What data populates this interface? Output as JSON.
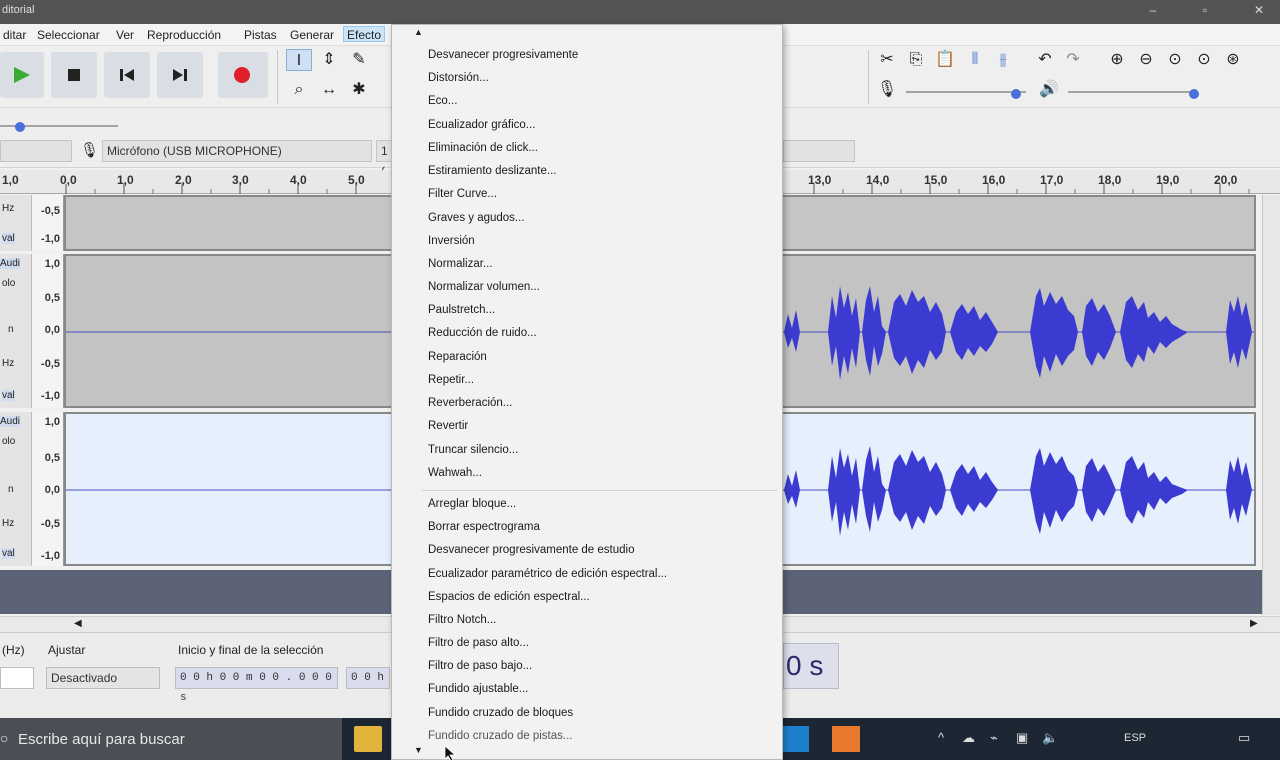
{
  "window": {
    "title": "ditorial"
  },
  "menubar": {
    "items": [
      "ditar",
      "Seleccionar",
      "Ver",
      "Reproducción",
      "Pistas",
      "Generar",
      "Efecto"
    ],
    "active": "Efecto"
  },
  "device_bar": {
    "microphone": "Micrófono (USB MICROPHONE)",
    "channels": "1 ("
  },
  "ruler": {
    "left_ticks": [
      "1,0",
      "0,0",
      "1,0",
      "2,0",
      "3,0",
      "4,0",
      "5,0"
    ],
    "right_ticks": [
      "13,0",
      "14,0",
      "15,0",
      "16,0",
      "17,0",
      "18,0",
      "19,0",
      "20,0"
    ]
  },
  "tracks": {
    "scale_top": [
      "-0,5",
      "-1,0"
    ],
    "scale_mid": [
      "1,0",
      "0,5",
      "0,0",
      "-0,5",
      "-1,0"
    ],
    "scale_bot": [
      "1,0",
      "0,5",
      "0,0",
      "-0,5",
      "-1,0"
    ],
    "ctl_labels_top": [
      "Hz",
      "val"
    ],
    "ctl_labels_mid": [
      "Audi",
      "olo",
      "n",
      "Hz",
      "val"
    ],
    "ctl_labels_bot": [
      "Audi",
      "olo",
      "n",
      "Hz",
      "val"
    ]
  },
  "bottom": {
    "rate_label": "(Hz)",
    "snap_label": "Ajustar",
    "snap_value": "Desactivado",
    "selection_label": "Inicio y final de la selección",
    "start_time": "0 0 h 0 0 m 0 0 . 0 0 0 s",
    "end_time": "0 0 h",
    "big_time": "0 s"
  },
  "taskbar": {
    "search_placeholder": "Escribe aquí para buscar",
    "lang": "ESP"
  },
  "effect_menu": {
    "items_group1": [
      "Desvanecer progresivamente",
      "Distorsión...",
      "Eco...",
      "Ecualizador gráfico...",
      "Eliminación de click...",
      "Estiramiento deslizante...",
      "Filter Curve...",
      "Graves y agudos...",
      "Inversión",
      "Normalizar...",
      "Normalizar volumen...",
      "Paulstretch...",
      "Reducción de ruido...",
      "Reparación",
      "Repetir...",
      "Reverberación...",
      "Revertir",
      "Truncar silencio...",
      "Wahwah..."
    ],
    "items_group2": [
      "Arreglar bloque...",
      "Borrar espectrograma",
      "Desvanecer progresivamente de estudio",
      "Ecualizador paramétrico de edición espectral...",
      "Espacios de edición espectral...",
      "Filtro Notch...",
      "Filtro de paso alto...",
      "Filtro de paso bajo...",
      "Fundido ajustable...",
      "Fundido cruzado de bloques",
      "Fundido cruzado de pistas..."
    ]
  },
  "colors": {
    "waveform": "#3b3bd1",
    "menu_bg": "#f2f2f2",
    "play": "#3aaa35",
    "record": "#e0202a"
  }
}
